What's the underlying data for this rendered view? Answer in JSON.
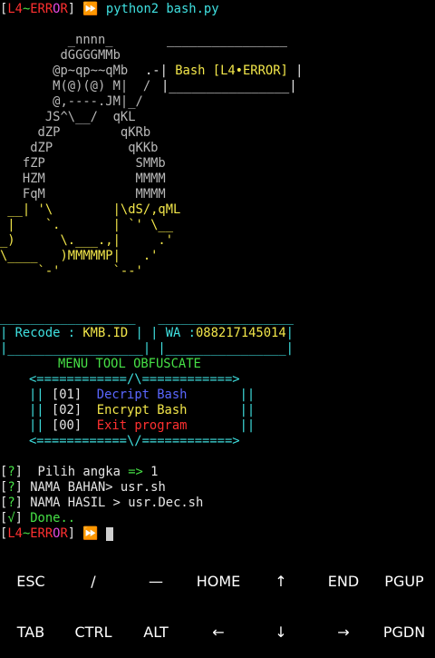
{
  "prompt": {
    "l": "[",
    "p1": "L4",
    "tilde": "~",
    "p2": "ERR",
    "p3": "O",
    "p4": "R",
    "r": "]",
    "arrow": " ⏩",
    "cmd": "python2 bash.py"
  },
  "art": [
    "         _nnnn_",
    "        dGGGGMMb     ",
    "       @p~qp~~qMb   ",
    "       M(@)(@) M|  /",
    "       @,----.JM|_/",
    "      JS^\\__/  qKL",
    "     dZP        qKRb",
    "    dZP          qKKb",
    "   fZP            SMMb",
    "   HZM            MMMM",
    "   FqM            MMMM",
    " __| '\\        |\\dS/,qML",
    " |    `.       | `' \\__",
    "_)      \\.___.,|     .'",
    "\\____   )MMMMMP|   .'",
    "     `-'       `--'"
  ],
  "banner_box": {
    "top": "________________",
    "mid_l": ".-| ",
    "text": "Bash [L4•ERROR]",
    "mid_r": " |",
    "bottom": "|________________|"
  },
  "info": {
    "top": "__________________   __________________",
    "recode_label": "| Recode : ",
    "recode_val": "KMB.ID",
    "sep": " | | WA :",
    "wa_val": "088217145014",
    "end": "|",
    "bottom": "|__________________| |________________|"
  },
  "menu": {
    "title": "MENU TOOL OBFUSCATE",
    "border_top": "<============/\\============>",
    "border_bottom": "<============\\/============>",
    "items": [
      {
        "num": "01",
        "label": "Decript Bash"
      },
      {
        "num": "02",
        "label": "Encrypt Bash"
      },
      {
        "num": "00",
        "label": "Exit program"
      }
    ]
  },
  "session": {
    "q": "?",
    "ok": "√",
    "pilih_label": "  Pilih angka ",
    "pilih_arrow": "=>",
    "pilih_val": " 1",
    "bahan_label": " NAMA BAHAN> ",
    "bahan_val": "usr.sh",
    "hasil_label": " NAMA HASIL > ",
    "hasil_val": "usr.Dec.sh",
    "done": " Done.."
  },
  "keys_row1": [
    "ESC",
    "/",
    "—",
    "HOME",
    "↑",
    "END",
    "PGUP"
  ],
  "keys_row2": [
    "TAB",
    "CTRL",
    "ALT",
    "←",
    "↓",
    "→",
    "PGDN"
  ]
}
